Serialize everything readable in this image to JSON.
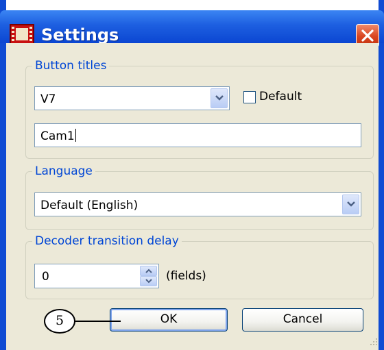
{
  "window": {
    "title": "Settings",
    "icon": "film-strip-icon",
    "close_icon": "close-x-icon"
  },
  "button_titles_group": {
    "legend": "Button titles",
    "selected": "V7",
    "default_checkbox": {
      "label": "Default",
      "checked": false
    },
    "title_value": "Cam1"
  },
  "language_group": {
    "legend": "Language",
    "selected": "Default (English)"
  },
  "delay_group": {
    "legend": "Decoder transition delay",
    "value": "0",
    "unit": "(fields)"
  },
  "buttons": {
    "ok": "OK",
    "cancel": "Cancel"
  },
  "callout": {
    "number": "5"
  },
  "colors": {
    "titlebar": "#0b46d2",
    "client": "#ece9d8",
    "legend_text": "#0046d5",
    "close": "#d9441f"
  }
}
